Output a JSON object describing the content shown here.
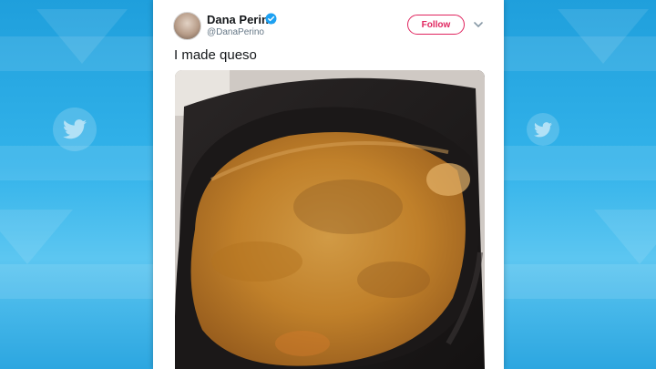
{
  "tweet": {
    "author_name": "Dana Perino",
    "handle": "@DanaPerino",
    "follow_label": "Follow",
    "text": "I made queso",
    "verified": true
  },
  "colors": {
    "background": "#2ca6e0",
    "follow_accent": "#e0245e",
    "verified_badge": "#1da1f2",
    "queso": "#c98a2d"
  },
  "icons": {
    "background_logo": "twitter-bird-icon",
    "verified": "verified-badge-icon",
    "menu": "chevron-down-icon"
  }
}
